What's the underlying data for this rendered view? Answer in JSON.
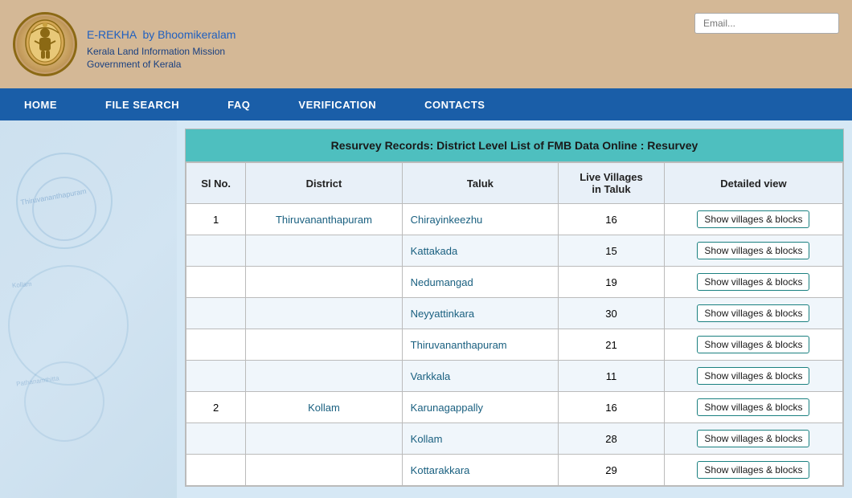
{
  "header": {
    "title": "E-REKHA",
    "by": "by Bhoomikeralam",
    "line1": "Kerala Land Information Mission",
    "line2": "Government of Kerala",
    "email_placeholder": "Email..."
  },
  "nav": {
    "items": [
      "HOME",
      "FILE SEARCH",
      "FAQ",
      "VERIFICATION",
      "CONTACTS"
    ]
  },
  "table": {
    "title": "Resurvey Records: District Level List of FMB Data Online : Resurvey",
    "columns": [
      "Sl No.",
      "District",
      "Taluk",
      "Live Villages in Taluk",
      "Detailed view"
    ],
    "rows": [
      {
        "sl": "1",
        "district": "Thiruvananthapuram",
        "taluk": "Chirayinkeezhu",
        "villages": "16",
        "btn": "Show villages & blocks"
      },
      {
        "sl": "",
        "district": "",
        "taluk": "Kattakada",
        "villages": "15",
        "btn": "Show villages & blocks"
      },
      {
        "sl": "",
        "district": "",
        "taluk": "Nedumangad",
        "villages": "19",
        "btn": "Show villages & blocks"
      },
      {
        "sl": "",
        "district": "",
        "taluk": "Neyyattinkara",
        "villages": "30",
        "btn": "Show villages & blocks"
      },
      {
        "sl": "",
        "district": "",
        "taluk": "Thiruvananthapuram",
        "villages": "21",
        "btn": "Show villages & blocks"
      },
      {
        "sl": "",
        "district": "",
        "taluk": "Varkkala",
        "villages": "11",
        "btn": "Show villages & blocks"
      },
      {
        "sl": "2",
        "district": "Kollam",
        "taluk": "Karunagappally",
        "villages": "16",
        "btn": "Show villages & blocks"
      },
      {
        "sl": "",
        "district": "",
        "taluk": "Kollam",
        "villages": "28",
        "btn": "Show villages & blocks"
      },
      {
        "sl": "",
        "district": "",
        "taluk": "Kottarakkara",
        "villages": "29",
        "btn": "Show villages & blocks"
      }
    ]
  }
}
